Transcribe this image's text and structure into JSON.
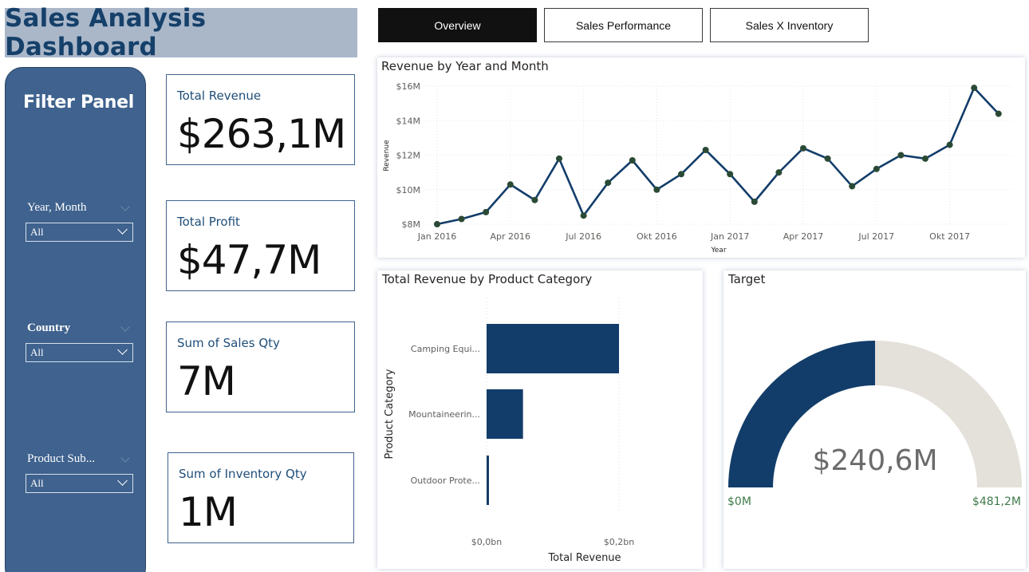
{
  "header": {
    "title": "Sales Analysis Dashboard"
  },
  "nav": {
    "overview": "Overview",
    "sales_performance": "Sales Performance",
    "sales_inventory": "Sales X Inventory",
    "active": "Overview"
  },
  "filter_panel": {
    "title": "Filter Panel",
    "slicers": [
      {
        "label": "Year, Month",
        "value": "All"
      },
      {
        "label": "Country",
        "value": "All"
      },
      {
        "label": "Product Sub...",
        "value": "All"
      }
    ]
  },
  "kpis": [
    {
      "label": "Total Revenue",
      "value": "$263,1M"
    },
    {
      "label": "Total Profit",
      "value": "$47,7M"
    },
    {
      "label": "Sum of Sales Qty",
      "value": "7M"
    },
    {
      "label": "Sum of Inventory Qty",
      "value": "1M"
    }
  ],
  "colors": {
    "primary": "#123d6a",
    "panel": "#3f628e",
    "title_bg": "#aab7c9",
    "marker": "#2b4a35",
    "gauge_rest": "#e4e0da",
    "gauge_label": "#3e7a4a"
  },
  "chart_data": [
    {
      "type": "line",
      "title": "Revenue by Year and Month",
      "xlabel": "Year",
      "ylabel": "Revenue",
      "x_ticks": [
        "Jan 2016",
        "Apr 2016",
        "Jul 2016",
        "Okt 2016",
        "Jan 2017",
        "Apr 2017",
        "Jul 2017",
        "Okt 2017"
      ],
      "y_ticks": [
        "$8M",
        "$10M",
        "$12M",
        "$14M",
        "$16M"
      ],
      "ylim": [
        8,
        16
      ],
      "unit": "$M",
      "x": [
        "2016-01",
        "2016-02",
        "2016-03",
        "2016-04",
        "2016-05",
        "2016-06",
        "2016-07",
        "2016-08",
        "2016-09",
        "2016-10",
        "2016-11",
        "2016-12",
        "2017-01",
        "2017-02",
        "2017-03",
        "2017-04",
        "2017-05",
        "2017-06",
        "2017-07",
        "2017-08",
        "2017-09",
        "2017-10",
        "2017-11",
        "2017-12"
      ],
      "values": [
        8.0,
        8.3,
        8.7,
        10.3,
        9.4,
        11.8,
        8.5,
        10.4,
        11.7,
        10.0,
        10.9,
        12.3,
        10.9,
        9.3,
        11.0,
        12.4,
        11.8,
        10.2,
        11.2,
        12.0,
        11.8,
        12.6,
        15.9,
        14.4
      ],
      "grid": true
    },
    {
      "type": "bar",
      "orientation": "horizontal",
      "title": "Total Revenue by Product Category",
      "xlabel": "Total Revenue",
      "ylabel": "Product Category",
      "categories": [
        "Camping Equi...",
        "Mountaineerin...",
        "Outdoor Prote..."
      ],
      "values": [
        0.2,
        0.055,
        0.003
      ],
      "x_ticks": [
        "$0,0bn",
        "$0,2bn"
      ],
      "xlim": [
        0,
        0.2
      ],
      "unit": "bn"
    },
    {
      "type": "gauge",
      "title": "Target",
      "value_label": "$240,6M",
      "min_label": "$0M",
      "max_label": "$481,2M",
      "value": 240.6,
      "min": 0,
      "max": 481.2
    }
  ]
}
